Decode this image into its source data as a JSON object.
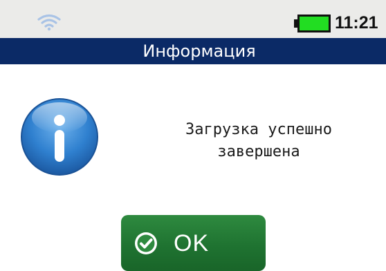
{
  "status_bar": {
    "wifi_icon": "wifi-icon",
    "battery_icon": "battery-icon",
    "battery_level": 1.0,
    "battery_color": "#22dd22",
    "time": "11:21"
  },
  "header": {
    "title": "Информация",
    "background": "#0b2a66"
  },
  "dialog": {
    "icon": "info-icon",
    "message_line1": "Загрузка успешно",
    "message_line2": "завершена"
  },
  "button": {
    "icon": "check-circle-icon",
    "label": "OK",
    "color": "#1f7331"
  }
}
